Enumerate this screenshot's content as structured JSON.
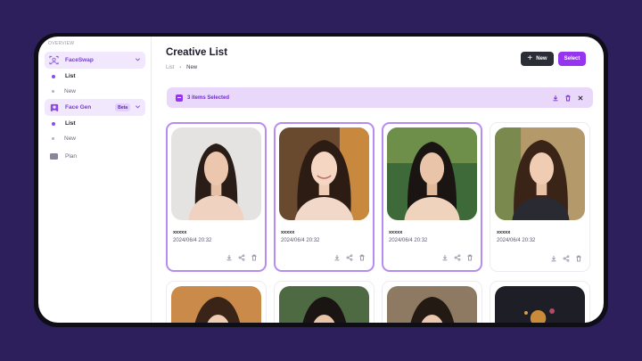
{
  "sidebar": {
    "overview_label": "OVERVIEW",
    "groups": [
      {
        "label": "FaceSwap",
        "icon": "face-scan-icon",
        "items": [
          {
            "label": "List",
            "active": true
          },
          {
            "label": "New",
            "active": false
          }
        ]
      },
      {
        "label": "Face Gen",
        "icon": "portrait-icon",
        "badge": "Beta",
        "items": [
          {
            "label": "List",
            "active": true
          },
          {
            "label": "New",
            "active": false
          }
        ]
      }
    ],
    "plan_label": "Plan"
  },
  "header": {
    "title": "Creative List",
    "breadcrumb": [
      "List",
      "New"
    ],
    "new_button": "New",
    "select_button": "Select"
  },
  "selection_bar": {
    "text": "3 items Selected"
  },
  "cards": [
    {
      "name": "xxxxx",
      "date": "2024/06/4 20:32",
      "selected": true
    },
    {
      "name": "xxxxx",
      "date": "2024/06/4 20:32",
      "selected": true
    },
    {
      "name": "xxxxx",
      "date": "2024/06/4 20:32",
      "selected": true
    },
    {
      "name": "xxxxx",
      "date": "2024/06/4 20:32",
      "selected": false
    }
  ],
  "colors": {
    "accent": "#9535f0",
    "background": "#2c1f5c",
    "selection_bar": "#ead8fb"
  }
}
